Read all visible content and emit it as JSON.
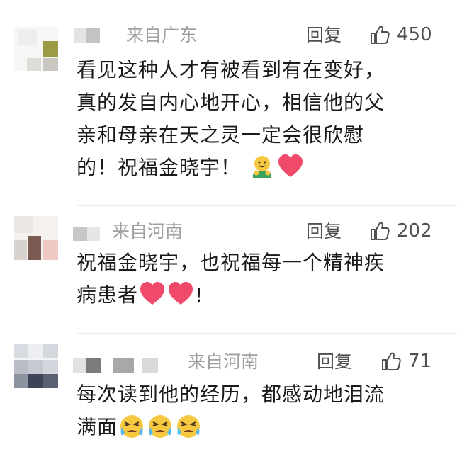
{
  "comments": [
    {
      "region": "来自广东",
      "reply_label": "回复",
      "likes": "450",
      "lines": [
        "看见这种人才有被看到有在变好，",
        "真的发自内心地开心，相信他的父",
        "亲和母亲在天之灵一定会很欣慰",
        "的！祝福金晓宇！"
      ],
      "emojis": [
        "hugging-face-emoji",
        "red-heart-emoji"
      ]
    },
    {
      "region": "来自河南",
      "reply_label": "回复",
      "likes": "202",
      "lines": [
        "祝福金晓宇，也祝福每一个精神疾",
        "病患者"
      ],
      "line2_tail": "!",
      "emojis": [
        "red-heart-emoji",
        "red-heart-emoji"
      ]
    },
    {
      "region": "来自河南",
      "reply_label": "回复",
      "likes": "71",
      "lines": [
        "每次读到他的经历，都感动地泪流",
        "满面"
      ],
      "emojis": [
        "crying-face-emoji",
        "crying-face-emoji",
        "crying-face-emoji"
      ]
    }
  ],
  "colors": {
    "text": "#1a1a1a",
    "meta": "#a0a0a0",
    "action": "#505050",
    "heart": "#ef4a6a"
  },
  "icons": {
    "like": "thumbs-up-icon"
  }
}
